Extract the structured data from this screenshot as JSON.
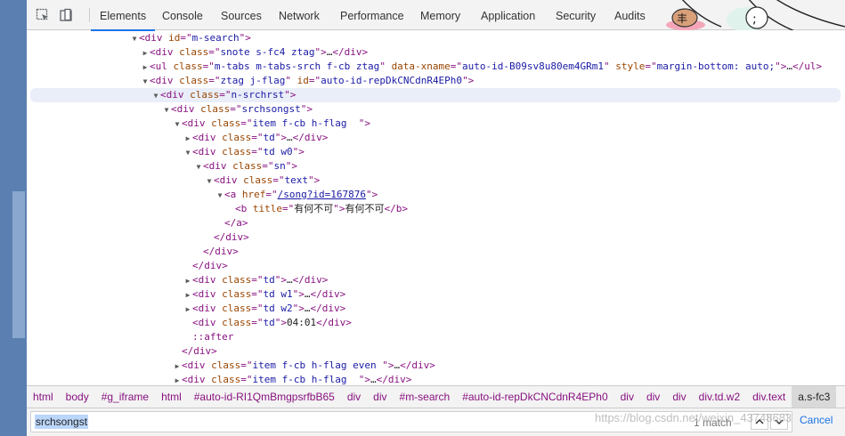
{
  "toolbar": {
    "tabs": [
      "Elements",
      "Console",
      "Sources",
      "Network",
      "Performance",
      "Memory",
      "Application",
      "Security",
      "Audits"
    ]
  },
  "dom": [
    {
      "indent": 7,
      "arrow": "open",
      "parts": [
        [
          "tag",
          "<div "
        ],
        [
          "attr",
          "id"
        ],
        [
          "tag",
          "=\""
        ],
        [
          "val",
          "m-search"
        ],
        [
          "tag",
          "\">"
        ]
      ]
    },
    {
      "indent": 8,
      "arrow": "closed",
      "parts": [
        [
          "tag",
          "<div "
        ],
        [
          "attr",
          "class"
        ],
        [
          "tag",
          "=\""
        ],
        [
          "val",
          "snote s-fc4 ztag"
        ],
        [
          "tag",
          "\">"
        ],
        [
          "txt",
          "…"
        ],
        [
          "tag",
          "</div>"
        ]
      ]
    },
    {
      "indent": 8,
      "arrow": "closed",
      "parts": [
        [
          "tag",
          "<ul "
        ],
        [
          "attr",
          "class"
        ],
        [
          "tag",
          "=\""
        ],
        [
          "val",
          "m-tabs m-tabs-srch f-cb ztag"
        ],
        [
          "tag",
          "\" "
        ],
        [
          "attr",
          "data-xname"
        ],
        [
          "tag",
          "=\""
        ],
        [
          "val",
          "auto-id-B09sv8u80em4GRm1"
        ],
        [
          "tag",
          "\" "
        ],
        [
          "attr",
          "style"
        ],
        [
          "tag",
          "=\""
        ],
        [
          "val",
          "margin-bottom: auto;"
        ],
        [
          "tag",
          "\">"
        ],
        [
          "txt",
          "…"
        ],
        [
          "tag",
          "</ul>"
        ]
      ]
    },
    {
      "indent": 8,
      "arrow": "open",
      "parts": [
        [
          "tag",
          "<div "
        ],
        [
          "attr",
          "class"
        ],
        [
          "tag",
          "=\""
        ],
        [
          "val",
          "ztag j-flag"
        ],
        [
          "tag",
          "\" "
        ],
        [
          "attr",
          "id"
        ],
        [
          "tag",
          "=\""
        ],
        [
          "val",
          "auto-id-repDkCNCdnR4EPh0"
        ],
        [
          "tag",
          "\">"
        ]
      ]
    },
    {
      "indent": 9,
      "arrow": "open",
      "selected": true,
      "parts": [
        [
          "tag",
          "<div "
        ],
        [
          "attr",
          "class"
        ],
        [
          "tag",
          "=\""
        ],
        [
          "val",
          "n-srchrst"
        ],
        [
          "tag",
          "\">"
        ]
      ]
    },
    {
      "indent": 10,
      "arrow": "open",
      "parts": [
        [
          "tag",
          "<div "
        ],
        [
          "attr",
          "class"
        ],
        [
          "tag",
          "=\""
        ],
        [
          "val",
          "srchsongst"
        ],
        [
          "tag",
          "\">"
        ]
      ]
    },
    {
      "indent": 11,
      "arrow": "open",
      "parts": [
        [
          "tag",
          "<div "
        ],
        [
          "attr",
          "class"
        ],
        [
          "tag",
          "=\""
        ],
        [
          "val",
          "item f-cb h-flag  "
        ],
        [
          "tag",
          "\">"
        ]
      ]
    },
    {
      "indent": 12,
      "arrow": "closed",
      "parts": [
        [
          "tag",
          "<div "
        ],
        [
          "attr",
          "class"
        ],
        [
          "tag",
          "=\""
        ],
        [
          "val",
          "td"
        ],
        [
          "tag",
          "\">"
        ],
        [
          "txt",
          "…"
        ],
        [
          "tag",
          "</div>"
        ]
      ]
    },
    {
      "indent": 12,
      "arrow": "open",
      "parts": [
        [
          "tag",
          "<div "
        ],
        [
          "attr",
          "class"
        ],
        [
          "tag",
          "=\""
        ],
        [
          "val",
          "td w0"
        ],
        [
          "tag",
          "\">"
        ]
      ]
    },
    {
      "indent": 13,
      "arrow": "open",
      "parts": [
        [
          "tag",
          "<div "
        ],
        [
          "attr",
          "class"
        ],
        [
          "tag",
          "=\""
        ],
        [
          "val",
          "sn"
        ],
        [
          "tag",
          "\">"
        ]
      ]
    },
    {
      "indent": 14,
      "arrow": "open",
      "parts": [
        [
          "tag",
          "<div "
        ],
        [
          "attr",
          "class"
        ],
        [
          "tag",
          "=\""
        ],
        [
          "val",
          "text"
        ],
        [
          "tag",
          "\">"
        ]
      ]
    },
    {
      "indent": 15,
      "arrow": "open",
      "parts": [
        [
          "tag",
          "<a "
        ],
        [
          "attr",
          "href"
        ],
        [
          "tag",
          "=\""
        ],
        [
          "link",
          "/song?id=167876"
        ],
        [
          "tag",
          "\">"
        ]
      ]
    },
    {
      "indent": 16,
      "arrow": "none",
      "parts": [
        [
          "tag",
          "<b "
        ],
        [
          "attr",
          "title"
        ],
        [
          "tag",
          "=\""
        ],
        [
          "cjk",
          "有何不可"
        ],
        [
          "tag",
          "\">"
        ],
        [
          "cjk",
          "有何不可"
        ],
        [
          "tag",
          "</b>"
        ]
      ]
    },
    {
      "indent": 15,
      "arrow": "none",
      "parts": [
        [
          "tag",
          "</a>"
        ]
      ]
    },
    {
      "indent": 14,
      "arrow": "none",
      "parts": [
        [
          "tag",
          "</div>"
        ]
      ]
    },
    {
      "indent": 13,
      "arrow": "none",
      "parts": [
        [
          "tag",
          "</div>"
        ]
      ]
    },
    {
      "indent": 12,
      "arrow": "none",
      "parts": [
        [
          "tag",
          "</div>"
        ]
      ]
    },
    {
      "indent": 12,
      "arrow": "closed",
      "parts": [
        [
          "tag",
          "<div "
        ],
        [
          "attr",
          "class"
        ],
        [
          "tag",
          "=\""
        ],
        [
          "val",
          "td"
        ],
        [
          "tag",
          "\">"
        ],
        [
          "txt",
          "…"
        ],
        [
          "tag",
          "</div>"
        ]
      ]
    },
    {
      "indent": 12,
      "arrow": "closed",
      "parts": [
        [
          "tag",
          "<div "
        ],
        [
          "attr",
          "class"
        ],
        [
          "tag",
          "=\""
        ],
        [
          "val",
          "td w1"
        ],
        [
          "tag",
          "\">"
        ],
        [
          "txt",
          "…"
        ],
        [
          "tag",
          "</div>"
        ]
      ]
    },
    {
      "indent": 12,
      "arrow": "closed",
      "parts": [
        [
          "tag",
          "<div "
        ],
        [
          "attr",
          "class"
        ],
        [
          "tag",
          "=\""
        ],
        [
          "val",
          "td w2"
        ],
        [
          "tag",
          "\">"
        ],
        [
          "txt",
          "…"
        ],
        [
          "tag",
          "</div>"
        ]
      ]
    },
    {
      "indent": 12,
      "arrow": "none",
      "parts": [
        [
          "tag",
          "<div "
        ],
        [
          "attr",
          "class"
        ],
        [
          "tag",
          "=\""
        ],
        [
          "val",
          "td"
        ],
        [
          "tag",
          "\">"
        ],
        [
          "txt",
          "04:01"
        ],
        [
          "tag",
          "</div>"
        ]
      ]
    },
    {
      "indent": 12,
      "arrow": "none",
      "parts": [
        [
          "pseudo",
          "::after"
        ]
      ]
    },
    {
      "indent": 11,
      "arrow": "none",
      "parts": [
        [
          "tag",
          "</div>"
        ]
      ]
    },
    {
      "indent": 11,
      "arrow": "closed",
      "parts": [
        [
          "tag",
          "<div "
        ],
        [
          "attr",
          "class"
        ],
        [
          "tag",
          "=\""
        ],
        [
          "val",
          "item f-cb h-flag even "
        ],
        [
          "tag",
          "\">"
        ],
        [
          "txt",
          "…"
        ],
        [
          "tag",
          "</div>"
        ]
      ]
    },
    {
      "indent": 11,
      "arrow": "closed",
      "parts": [
        [
          "tag",
          "<div "
        ],
        [
          "attr",
          "class"
        ],
        [
          "tag",
          "=\""
        ],
        [
          "val",
          "item f-cb h-flag  "
        ],
        [
          "tag",
          "\">"
        ],
        [
          "txt",
          "…"
        ],
        [
          "tag",
          "</div>"
        ]
      ]
    }
  ],
  "breadcrumbs": [
    "html",
    "body",
    "#g_iframe",
    "html",
    "#auto-id-RI1QmBmgpsrfbB65",
    "div",
    "div",
    "#m-search",
    "#auto-id-repDkCNCdnR4EPh0",
    "div",
    "div",
    "div",
    "div.td.w2",
    "div.text",
    "a.s-fc3"
  ],
  "search": {
    "value": "srchsongst",
    "match_count": "1 match",
    "cancel_label": "Cancel"
  },
  "watermark": "https://blog.csdn.net/weixin_43748683",
  "colors": {
    "tag": "#881280",
    "attr_name": "#994500",
    "attr_value": "#1a1aa6",
    "active_tab_underline": "#1a73e8",
    "selected_row": "#e9eef8"
  }
}
